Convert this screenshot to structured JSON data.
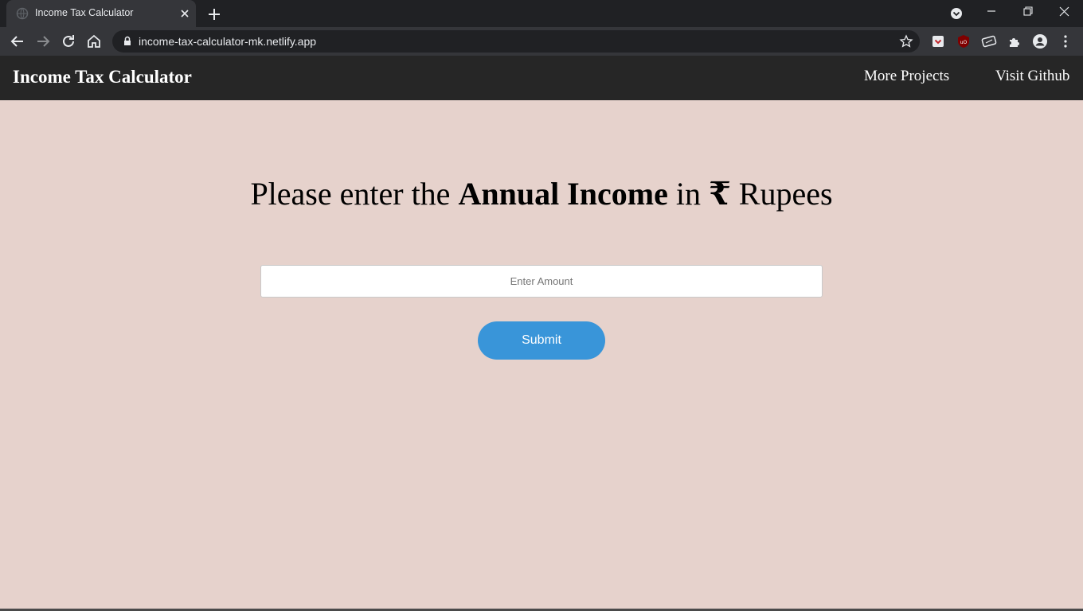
{
  "browser": {
    "tab_title": "Income Tax Calculator",
    "url": "income-tax-calculator-mk.netlify.app"
  },
  "navbar": {
    "brand": "Income Tax Calculator",
    "links": [
      "More Projects",
      "Visit Github"
    ]
  },
  "main": {
    "heading_pre": "Please enter the ",
    "heading_bold": "Annual Income",
    "heading_mid": " in ",
    "currency_symbol": "₹",
    "heading_post": " Rupees",
    "input_placeholder": "Enter Amount",
    "submit_label": "Submit"
  },
  "colors": {
    "page_background": "#e6d2cc",
    "navbar_background": "#262626",
    "submit_button": "#3995d9"
  }
}
